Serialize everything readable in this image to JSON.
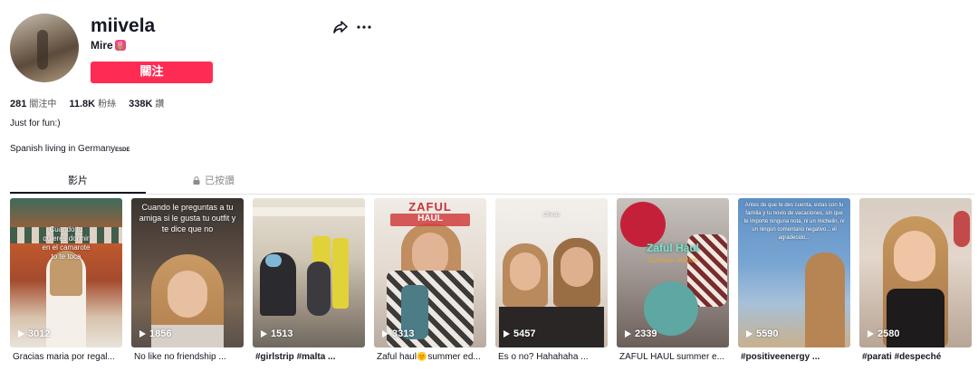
{
  "profile": {
    "username": "miivela",
    "nickname": "Mire",
    "nickname_emoji": "🌷",
    "follow_label": "關注",
    "accent": "#fe2c55"
  },
  "stats": [
    {
      "value": "281",
      "label": "關注中"
    },
    {
      "value": "11.8K",
      "label": "粉絲"
    },
    {
      "value": "338K",
      "label": "讚"
    }
  ],
  "bio": {
    "line1": "Just for fun:)",
    "line2_text": "Spanish living in Germany",
    "line2_flags": "ESDE"
  },
  "tabs": {
    "videos": "影片",
    "liked": "已按讚"
  },
  "videos": [
    {
      "views": "3012",
      "caption": "Gracias maria por regal...",
      "overlay": "Cuando tu quieres dormir en el camarote to te toca"
    },
    {
      "views": "1856",
      "caption": "No like no friendship ...",
      "overlay": "Cuando le preguntas a tu amiga si le gusta tu outfit y te dice que no"
    },
    {
      "views": "1513",
      "caption": "#girlstrip #malta ...",
      "overlay": ""
    },
    {
      "views": "3313",
      "caption": "Zaful haul🌞summer ed...",
      "overlay": "ZAFUL HAUL Summer edition"
    },
    {
      "views": "5457",
      "caption": "Es o no? Hahahaha ...",
      "overlay": "Chicas"
    },
    {
      "views": "2339",
      "caption": "ZAFUL HAUL summer e...",
      "overlay": "Zaful Haul Summer edition"
    },
    {
      "views": "5590",
      "caption": "#positiveenergy ...",
      "overlay": "Antes de que te des cuenta, estas con tu familia y tu novio de vacaciones, sin que te importe ninguna nota, ni un michelin, ni un ningún comentario negativo... el agradecido..."
    },
    {
      "views": "2580",
      "caption": "#parati #despeché",
      "overlay": ""
    }
  ]
}
